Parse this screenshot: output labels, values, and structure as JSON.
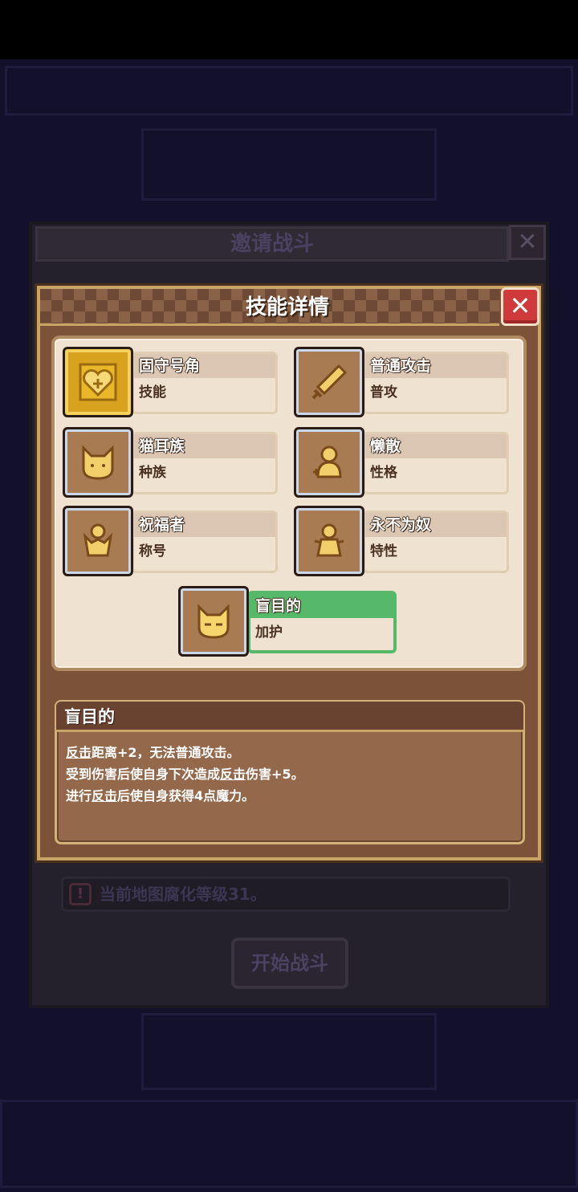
{
  "background": {
    "invite_dialog": {
      "title": "邀请战斗",
      "close_glyph": "✕",
      "notice_icon": "!",
      "notice_text": "当前地图腐化等级31。",
      "start_button": "开始战斗"
    }
  },
  "skill_dialog": {
    "title": "技能详情",
    "close_glyph": "✕",
    "close_icon": "close-icon",
    "cards": [
      {
        "name": "固守号角",
        "type": "技能",
        "icon": "golden-heart-shield-icon"
      },
      {
        "name": "普通攻击",
        "type": "普攻",
        "icon": "sword-icon"
      },
      {
        "name": "猫耳族",
        "type": "种族",
        "icon": "cat-head-icon"
      },
      {
        "name": "懒散",
        "type": "性格",
        "icon": "lazy-figure-icon"
      },
      {
        "name": "祝福者",
        "type": "称号",
        "icon": "blessed-figure-icon"
      },
      {
        "name": "永不为奴",
        "type": "特性",
        "icon": "free-figure-icon"
      },
      {
        "name": "盲目的",
        "type": "加护",
        "icon": "blind-cat-icon",
        "selected": true
      }
    ],
    "description": {
      "title": "盲目的",
      "line1": {
        "a": "反击",
        "b": "距离+2，无法普通攻击。"
      },
      "line2": {
        "a": "受到伤害后使自身下次造成",
        "b": "反击",
        "c": "伤害+5。"
      },
      "line3": {
        "a": "进行",
        "b": "反击",
        "c": "后使自身获得4点魔力。"
      }
    }
  },
  "colors": {
    "panel_brown": "#7c5238",
    "panel_gold_border": "#c8a465",
    "card_bg": "#efe2d0",
    "selected_green": "#56b96a",
    "close_red": "#d13a3a"
  }
}
